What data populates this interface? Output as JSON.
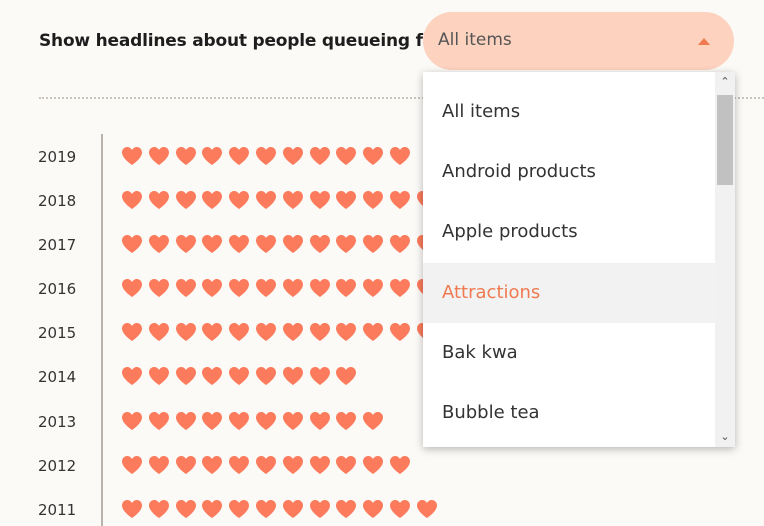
{
  "filter": {
    "label": "Show headlines about people queueing for",
    "selected": "All items"
  },
  "dropdown": {
    "options": [
      "All items",
      "Android products",
      "Apple products",
      "Attractions",
      "Bak kwa",
      "Bubble tea"
    ],
    "highlighted_index": 3
  },
  "colors": {
    "accent": "#f07a50",
    "heart": "#fb7b5c",
    "select_bg": "#fdd2bf"
  },
  "icons": {
    "heart": "heart-icon",
    "caret": "caret-up-icon",
    "scroll_up": "chevron-up-icon",
    "scroll_down": "chevron-down-icon"
  },
  "chart_data": {
    "type": "bar",
    "categories": [
      "2019",
      "2018",
      "2017",
      "2016",
      "2015",
      "2014",
      "2013",
      "2012",
      "2011"
    ],
    "series": [
      {
        "values": [
          11,
          12,
          12,
          12,
          12,
          9,
          10,
          11,
          12
        ]
      }
    ]
  }
}
